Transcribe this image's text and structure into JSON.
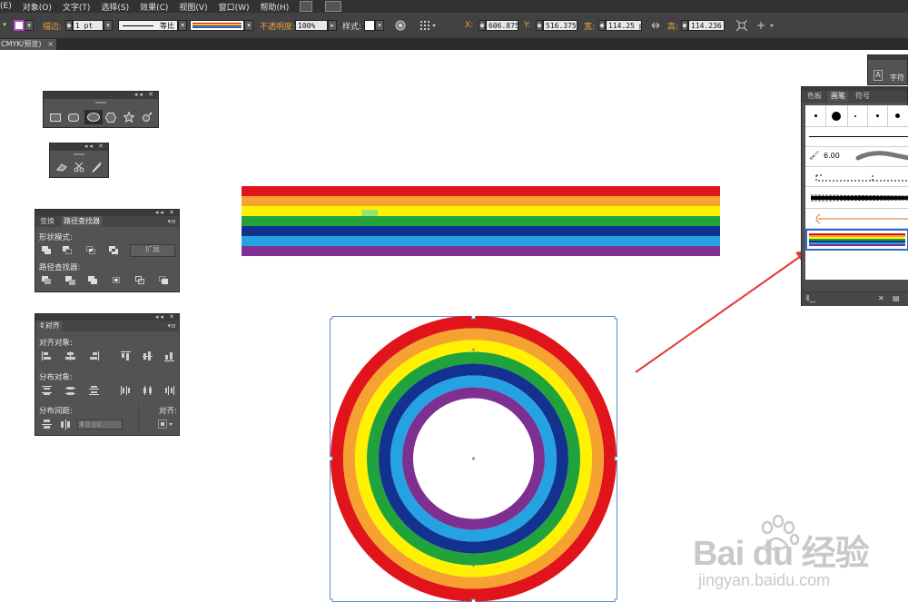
{
  "menubar": {
    "items": [
      "(E)",
      "对象(O)",
      "文字(T)",
      "选择(S)",
      "效果(C)",
      "视图(V)",
      "窗口(W)",
      "帮助(H)"
    ]
  },
  "controlbar": {
    "stroke_label": "描边:",
    "stroke_weight": "1 pt",
    "profile_label": "等比",
    "opacity_label": "不透明度:",
    "opacity_value": "100%",
    "style_label": "样式:",
    "x_label": "X:",
    "x_value": "606.875",
    "y_label": "Y:",
    "y_value": "516.375",
    "w_label": "宽:",
    "w_value": "114.25 p",
    "h_label": "高:",
    "h_value": "114.236"
  },
  "doc_tab": {
    "title": "CMYK/预览)",
    "close": "×"
  },
  "shapes_panel": {
    "tools": [
      "rectangle-icon",
      "rounded-rect-icon",
      "ellipse-icon",
      "polygon-icon",
      "star-icon",
      "flare-icon"
    ]
  },
  "eraser_panel": {
    "tools": [
      "eraser-icon",
      "scissors-icon",
      "knife-icon"
    ]
  },
  "pathfinder_panel": {
    "tabs": [
      "变换",
      "路径查找器"
    ],
    "shape_modes_label": "形状模式:",
    "expand_label": "扩展",
    "pathfinders_label": "路径查找器:"
  },
  "align_panel": {
    "tab": "对齐",
    "align_objects_label": "对齐对象:",
    "distribute_objects_label": "分布对象:",
    "distribute_spacing_label": "分布间距:",
    "align_to_label": "对齐:",
    "spacing_value": "0 px"
  },
  "brushes_panel": {
    "tabs": [
      "色板",
      "画笔",
      "符号"
    ],
    "brush_size": "6.00"
  },
  "char_panel": {
    "label": "字符"
  },
  "rainbow_colors": [
    "#e2141b",
    "#f5a230",
    "#fff100",
    "#21a33c",
    "#13328f",
    "#24a2e2",
    "#7e3092"
  ],
  "arrow_color": "#e03a3a",
  "watermark": {
    "main": "Bai du 经验",
    "url": "jingyan.baidu.com"
  }
}
